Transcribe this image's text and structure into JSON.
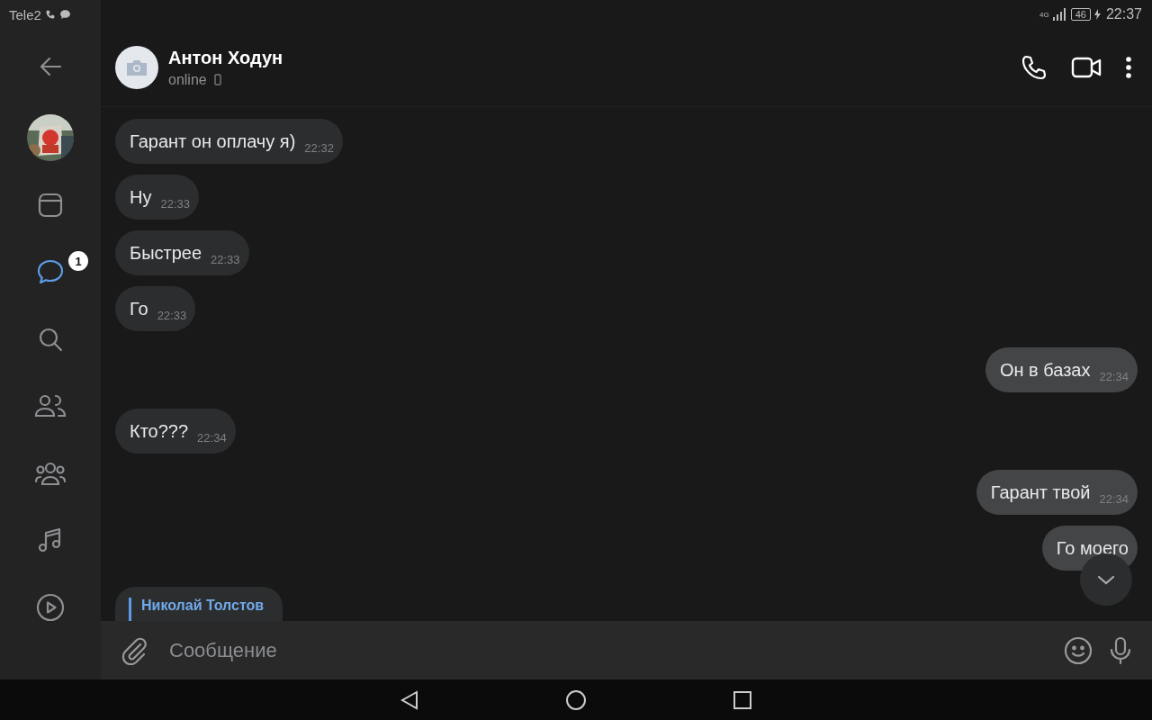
{
  "status_bar": {
    "carrier": "Tele2",
    "network": "4G",
    "battery": "46",
    "time": "22:37"
  },
  "sidebar": {
    "items": [
      {
        "kind": "back",
        "selected": false
      },
      {
        "kind": "profile",
        "selected": false
      },
      {
        "kind": "feed",
        "selected": false
      },
      {
        "kind": "messages",
        "selected": true,
        "badge": "1"
      },
      {
        "kind": "search",
        "selected": false
      },
      {
        "kind": "friends",
        "selected": false
      },
      {
        "kind": "communities",
        "selected": false
      },
      {
        "kind": "music",
        "selected": false
      },
      {
        "kind": "video",
        "selected": false
      }
    ]
  },
  "header": {
    "name": "Антон Ходун",
    "status": "online"
  },
  "messages": [
    {
      "text": "Гарант он оплачу я)",
      "time": "22:32",
      "outgoing": false
    },
    {
      "text": "Ну",
      "time": "22:33",
      "outgoing": false
    },
    {
      "text": "Быстрее",
      "time": "22:33",
      "outgoing": false
    },
    {
      "text": "Го",
      "time": "22:33",
      "outgoing": false
    },
    {
      "text": "Он в базах",
      "time": "22:34",
      "outgoing": true
    },
    {
      "text": "Кто???",
      "time": "22:34",
      "outgoing": false
    },
    {
      "text": "Гарант твой",
      "time": "22:34",
      "outgoing": true
    },
    {
      "text": "Го моего",
      "outgoing": true
    }
  ],
  "reply_preview": {
    "author": "Николай Толстов"
  },
  "composer": {
    "placeholder": "Сообщение"
  }
}
